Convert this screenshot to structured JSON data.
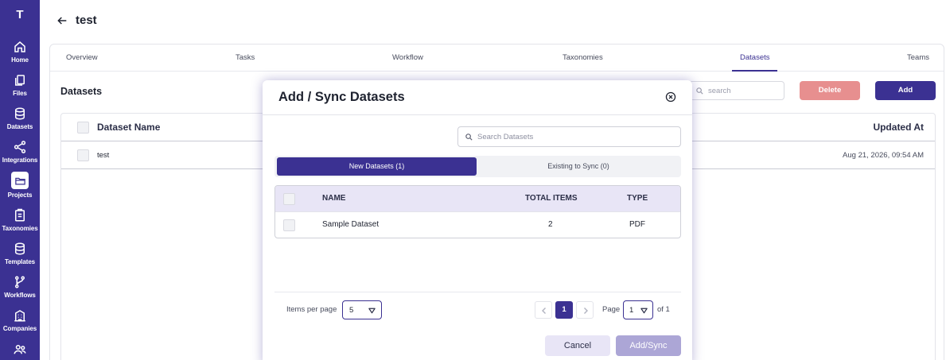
{
  "app": {
    "logo": "T",
    "accent": "#3b3192"
  },
  "sidebar": {
    "items": [
      {
        "label": "Home",
        "icon": "home-icon"
      },
      {
        "label": "Files",
        "icon": "files-icon"
      },
      {
        "label": "Datasets",
        "icon": "database-icon"
      },
      {
        "label": "Integrations",
        "icon": "share-icon"
      },
      {
        "label": "Projects",
        "icon": "folder-icon",
        "active": true
      },
      {
        "label": "Taxonomies",
        "icon": "clipboard-icon"
      },
      {
        "label": "Templates",
        "icon": "database-icon"
      },
      {
        "label": "Workflows",
        "icon": "branch-icon"
      },
      {
        "label": "Companies",
        "icon": "building-icon"
      },
      {
        "label": "",
        "icon": "users-icon"
      }
    ]
  },
  "header": {
    "title": "test"
  },
  "tabs": [
    "Overview",
    "Tasks",
    "Workflow",
    "Taxonomies",
    "Datasets",
    "Teams"
  ],
  "active_tab": "Datasets",
  "section": {
    "title": "Datasets",
    "search_placeholder": "search",
    "delete_label": "Delete",
    "add_label": "Add"
  },
  "table": {
    "columns": {
      "name": "Dataset Name",
      "updated": "Updated At"
    },
    "rows": [
      {
        "name": "test",
        "updated": "Aug 21, 2026, 09:54 AM"
      }
    ]
  },
  "modal": {
    "title": "Add / Sync Datasets",
    "search_placeholder": "Search Datasets",
    "tab_new": "New Datasets (1)",
    "tab_existing": "Existing to Sync (0)",
    "columns": {
      "name": "NAME",
      "total": "TOTAL ITEMS",
      "type": "TYPE"
    },
    "rows": [
      {
        "name": "Sample Dataset",
        "total": "2",
        "type": "PDF"
      }
    ],
    "items_per_page_label": "Items per page",
    "items_per_page_value": "5",
    "current_page": "1",
    "page_label": "Page",
    "page_select_value": "1",
    "of_label": "of 1",
    "cancel_label": "Cancel",
    "submit_label": "Add/Sync"
  }
}
